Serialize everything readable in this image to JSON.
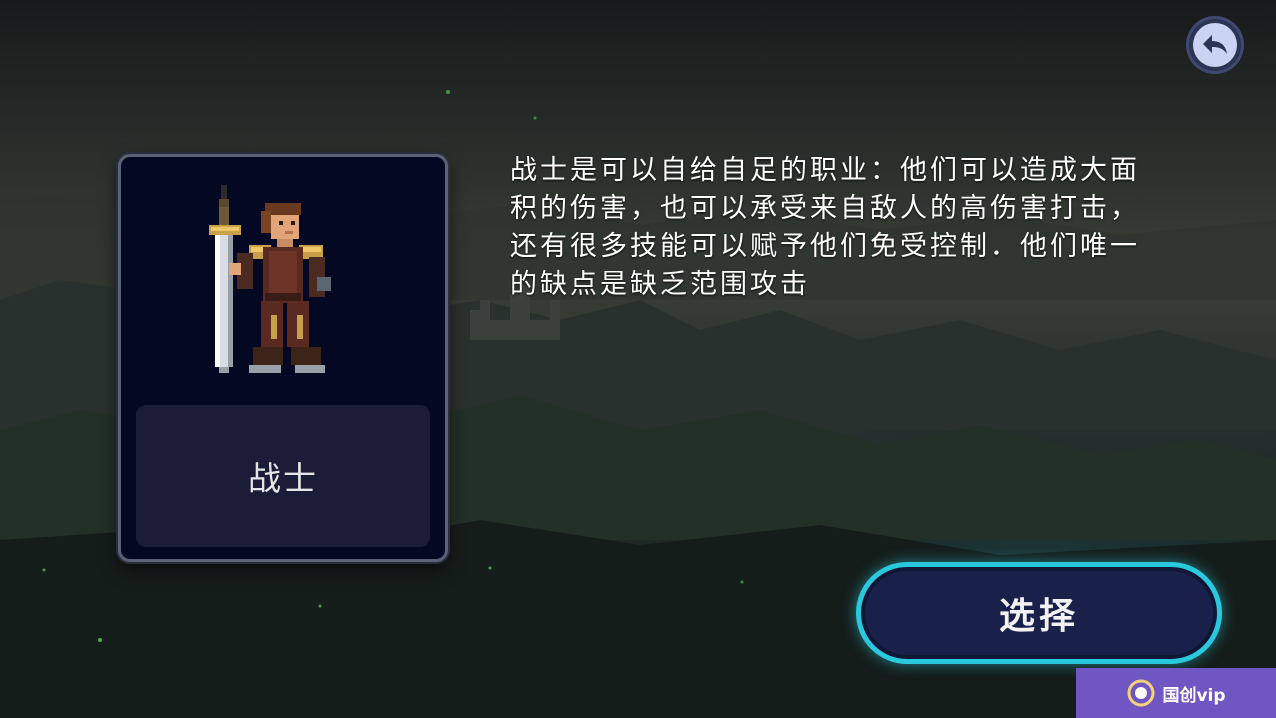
{
  "screen": {
    "back_button_icon": "back-arrow-icon"
  },
  "class_card": {
    "name": "战士",
    "portrait_icon": "warrior-with-sword-sprite"
  },
  "description": "战士是可以自给自足的职业：他们可以造成大面积的伤害，也可以承受来自敌人的高伤害打击，还有很多技能可以赋予他们免受控制．他们唯一的缺点是缺乏范围攻击",
  "select_button": {
    "label": "选择"
  },
  "watermark": {
    "text": "国创vip"
  },
  "colors": {
    "card_bg": "#050822",
    "name_plate": "#1b1c38",
    "select_border": "#2ac8dc",
    "select_fill": "#19214a",
    "back_button": "#c9d3f2",
    "watermark_bg": "#6f56c2"
  }
}
